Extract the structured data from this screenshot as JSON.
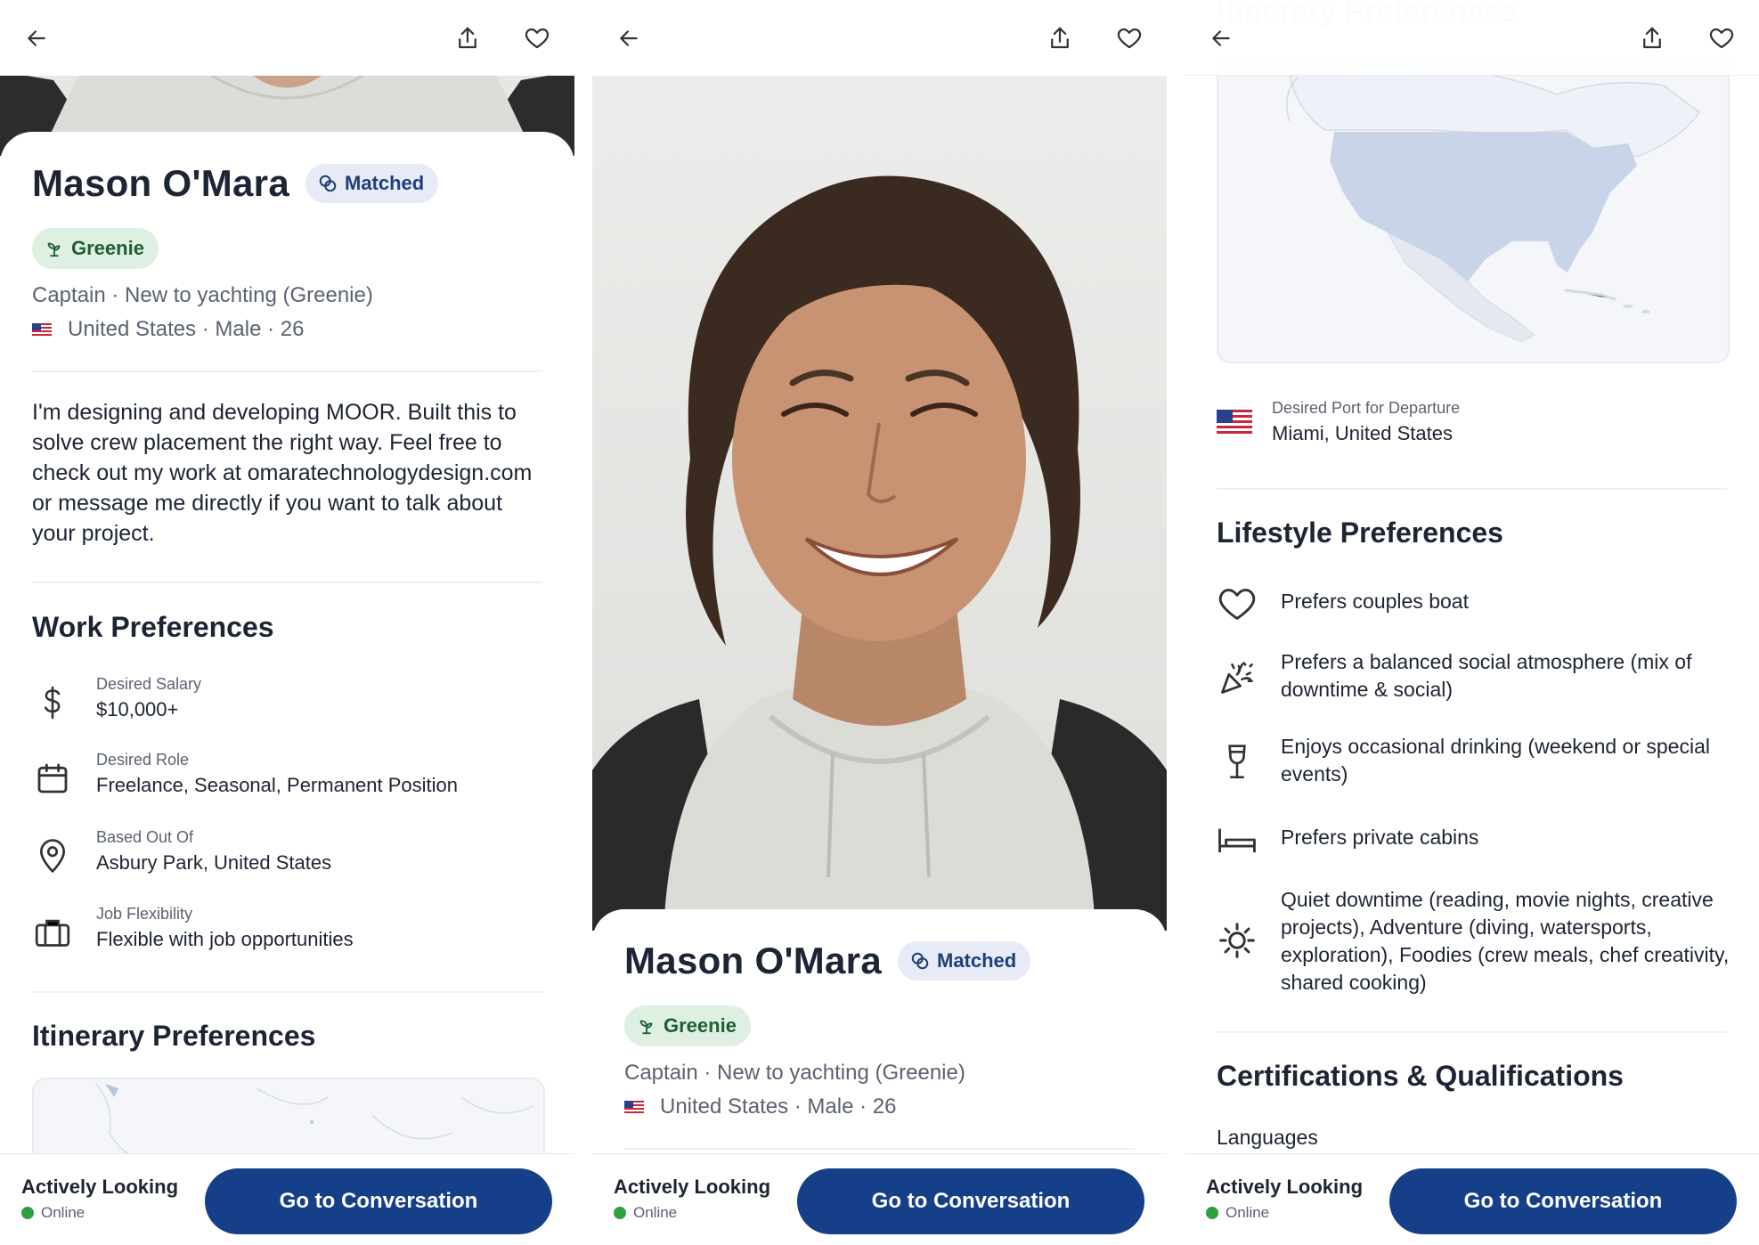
{
  "profile": {
    "name": "Mason O'Mara",
    "matched_badge": "Matched",
    "greenie_badge": "Greenie",
    "role_line": "Captain · New to yachting (Greenie)",
    "location_line": "United States · Male · 26",
    "bio": "I'm designing and developing MOOR. Built this to solve crew placement the right way. Feel free to check out my work at omaratechnologydesign.com or message me directly if you want to talk about your project."
  },
  "work": {
    "title": "Work Preferences",
    "items": [
      {
        "label": "Desired Salary",
        "value": "$10,000+",
        "icon": "dollar-icon"
      },
      {
        "label": "Desired Role",
        "value": "Freelance, Seasonal, Permanent Position",
        "icon": "calendar-icon"
      },
      {
        "label": "Based Out Of",
        "value": "Asbury Park, United States",
        "icon": "location-pin-icon"
      },
      {
        "label": "Job Flexibility",
        "value": "Flexible with job opportunities",
        "icon": "briefcase-icon"
      }
    ]
  },
  "itinerary": {
    "title": "Itinerary Preferences",
    "port_label": "Desired Port for Departure",
    "port_value": "Miami, United States"
  },
  "lifestyle": {
    "title": "Lifestyle Preferences",
    "items": [
      {
        "text": "Prefers couples boat",
        "icon": "heart-icon"
      },
      {
        "text": "Prefers a balanced social atmosphere (mix of downtime & social)",
        "icon": "party-popper-icon"
      },
      {
        "text": "Enjoys occasional drinking (weekend or special events)",
        "icon": "wine-glass-icon"
      },
      {
        "text": "Prefers private cabins",
        "icon": "bed-icon"
      },
      {
        "text": "Quiet downtime (reading, movie nights, creative projects), Adventure (diving, watersports, exploration), Foodies (crew meals, chef creativity, shared cooking)",
        "icon": "sun-icon"
      }
    ]
  },
  "certifications": {
    "title": "Certifications & Qualifications",
    "languages_label": "Languages"
  },
  "footer": {
    "status": "Actively Looking",
    "online": "Online",
    "cta": "Go to Conversation"
  },
  "colors": {
    "primary": "#163f8a",
    "matched_bg": "#e6ebf6",
    "greenie_bg": "#def0e2",
    "online_dot": "#2ea043"
  }
}
